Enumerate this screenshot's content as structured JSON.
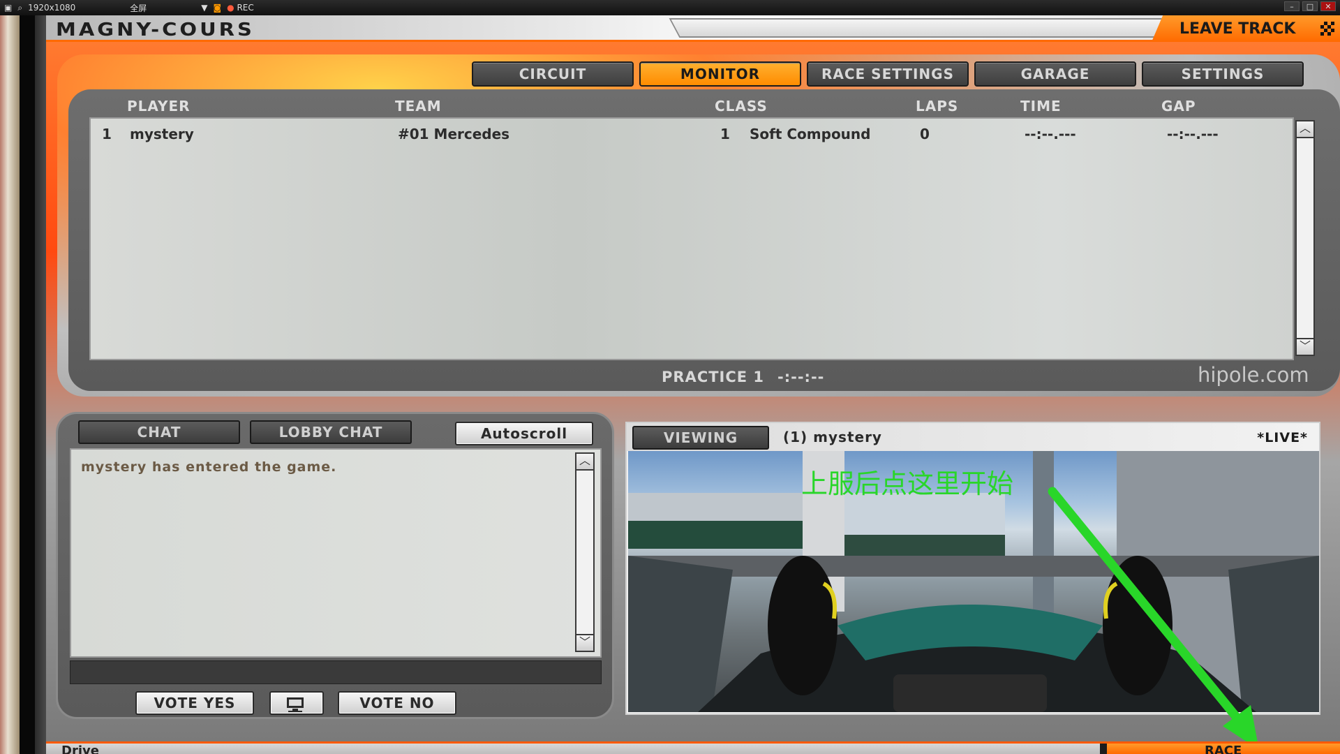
{
  "capture_bar": {
    "resolution": "1920x1080",
    "mode": "全屏",
    "rec": "REC"
  },
  "title": {
    "track": "MAGNY-COURS",
    "leave_track": "LEAVE TRACK"
  },
  "tabs": [
    {
      "label": "CIRCUIT",
      "active": false
    },
    {
      "label": "MONITOR",
      "active": true
    },
    {
      "label": "RACE SETTINGS",
      "active": false
    },
    {
      "label": "GARAGE",
      "active": false
    },
    {
      "label": "SETTINGS",
      "active": false
    }
  ],
  "standings": {
    "columns": [
      "PLAYER",
      "TEAM",
      "CLASS",
      "LAPS",
      "TIME",
      "GAP"
    ],
    "rows": [
      {
        "pos": "1",
        "player": "mystery",
        "team": "#01 Mercedes",
        "class_num": "1",
        "class_name": "Soft Compound",
        "laps": "0",
        "time": "--:--.---",
        "gap": "--:--.---"
      }
    ]
  },
  "session": {
    "name": "PRACTICE 1",
    "clock": "-:--:--"
  },
  "watermark": "hipole.com",
  "chat": {
    "tab_chat": "CHAT",
    "tab_lobby": "LOBBY CHAT",
    "autoscroll": "Autoscroll",
    "messages": [
      "mystery has entered the game."
    ]
  },
  "votes": {
    "yes": "VOTE YES",
    "no": "VOTE NO"
  },
  "viewer": {
    "viewing_label": "VIEWING",
    "target": "(1) mystery",
    "live": "*LIVE*"
  },
  "annotation": {
    "text": "上服后点这里开始",
    "color": "#29d629"
  },
  "bottom": {
    "drive": "Drive",
    "race": "RACE"
  },
  "colors": {
    "accent": "#ff8c00",
    "panel": "#5a5a5a"
  }
}
